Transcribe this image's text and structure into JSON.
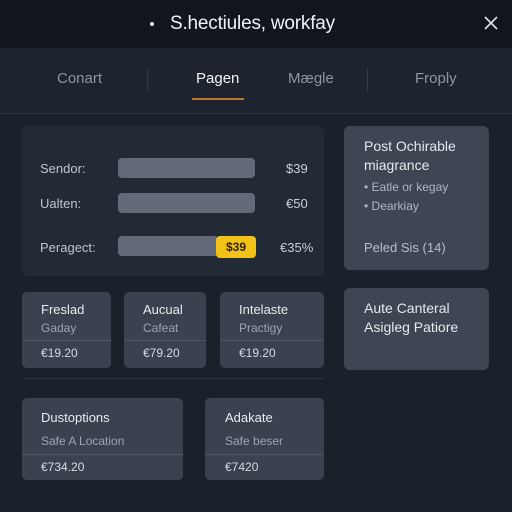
{
  "window": {
    "title": "S.hectiules, workfay",
    "close_icon": "close-icon"
  },
  "tabs": [
    {
      "label": "Conart",
      "active": false
    },
    {
      "label": "Pagen",
      "active": true
    },
    {
      "label": "Mægle",
      "active": false
    },
    {
      "label": "Froply",
      "active": false
    }
  ],
  "form": {
    "rows": [
      {
        "label": "Sendor:",
        "value": "$39"
      },
      {
        "label": "Ualten:",
        "value": "€50"
      },
      {
        "label": "Peragect:",
        "badge": "$39",
        "value": "€35%"
      }
    ]
  },
  "side_panel": {
    "title_line1": "Post Ochirable",
    "title_line2": "miagrance",
    "bullets": [
      "• Eatle or kegay",
      "• Dearkiay"
    ],
    "footer": "Peled Sis (14)"
  },
  "side_panel_2": {
    "title_line1": "Aute Canteral",
    "title_line2": "Asigleg Patiore"
  },
  "cards_row1": [
    {
      "title": "Freslad",
      "subtitle": "Gaday",
      "amount": "€19.20"
    },
    {
      "title": "Aucual",
      "subtitle": "Cafeat",
      "amount": "€79.20"
    },
    {
      "title": "Intelaste",
      "subtitle": "Practigy",
      "amount": "€19.20"
    }
  ],
  "cards_row2": [
    {
      "title": "Dustoptions",
      "subtitle": "Safe A Location",
      "amount": "€734.20"
    },
    {
      "title": "Adakate",
      "subtitle": "Safe beser",
      "amount": "€7420"
    }
  ],
  "colors": {
    "accent_underline": "#b9732e",
    "badge": "#f2c218"
  }
}
